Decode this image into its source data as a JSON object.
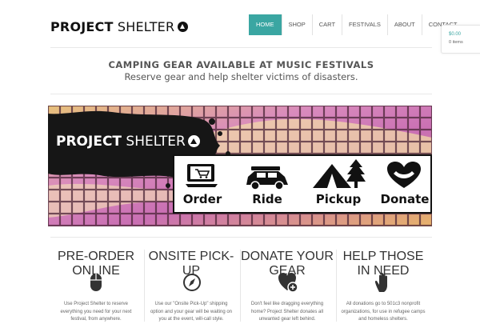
{
  "header": {
    "logo_bold": "PROJECT",
    "logo_light": "SHELTER",
    "logo_icon": "tent-circle-icon"
  },
  "nav": {
    "items": [
      {
        "label": "HOME",
        "active": true
      },
      {
        "label": "SHOP"
      },
      {
        "label": "CART"
      },
      {
        "label": "FESTIVALS"
      },
      {
        "label": "ABOUT"
      },
      {
        "label": "CONTACT"
      }
    ],
    "accent": "#3aa6a2"
  },
  "cart": {
    "total": "$0.00",
    "items": "0 items"
  },
  "intro": {
    "headline": "CAMPING GEAR AVAILABLE AT MUSIC FESTIVALS",
    "subhead": "Reserve gear and help shelter victims of disasters."
  },
  "banner": {
    "logo_bold": "PROJECT",
    "logo_light": "SHELTER",
    "steps": [
      {
        "label": "Order",
        "icon": "laptop-cart-icon"
      },
      {
        "label": "Ride",
        "icon": "car-gear-icon"
      },
      {
        "label": "Pickup",
        "icon": "tent-tree-icon"
      },
      {
        "label": "Donate",
        "icon": "heart-hands-icon"
      }
    ]
  },
  "features": [
    {
      "title": "PRE-ORDER ONLINE",
      "icon": "mouse-icon",
      "text": "Use Project Shelter to reserve everything you need for your next festival, from anywhere."
    },
    {
      "title": "ONSITE PICK-UP",
      "icon": "compass-icon",
      "text": "Use our \"Onsite Pick-Up\" shipping option and your gear will be waiting on you at the event, will-call style."
    },
    {
      "title": "DONATE YOUR GEAR",
      "icon": "heart-plus-icon",
      "text": "Don't feel like dragging everything home? Project Shelter donates all unwanted gear left behind."
    },
    {
      "title": "HELP THOSE IN NEED",
      "icon": "hand-icon",
      "text": "All donations go to 501c3 nonprofit organizations, for use in refugee camps and homeless shelters."
    }
  ]
}
